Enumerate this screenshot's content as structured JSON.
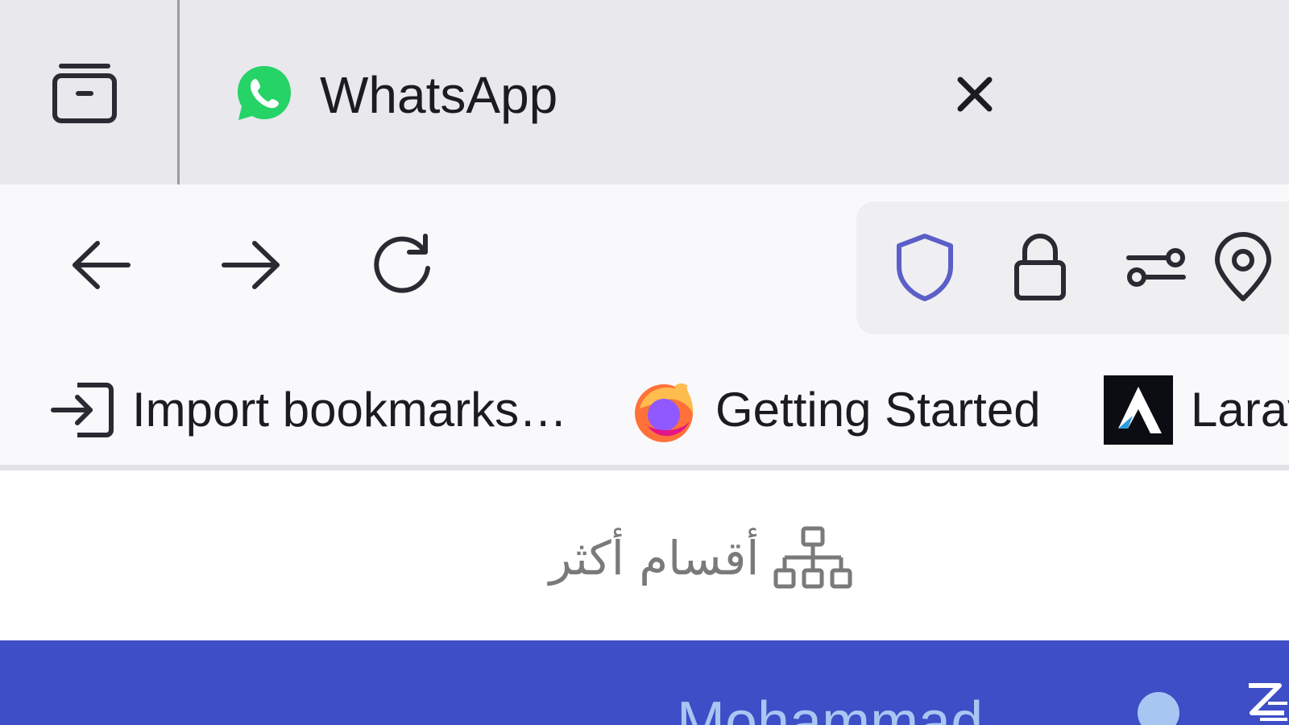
{
  "tabs": [
    {
      "title": "WhatsApp",
      "favicon": "whatsapp-icon",
      "close_icon": "close-icon"
    }
  ],
  "tab_manager_icon": "tab-manager-icon",
  "navigation": {
    "back_icon": "arrow-left-icon",
    "forward_icon": "arrow-right-icon",
    "reload_icon": "reload-icon"
  },
  "urlbar": {
    "icons": [
      "shield-icon",
      "lock-icon",
      "permissions-icon",
      "location-icon"
    ],
    "shield_color": "#5b5fc7"
  },
  "bookmarks": [
    {
      "label": "Import bookmarks…",
      "icon": "import-icon"
    },
    {
      "label": "Getting Started",
      "icon": "firefox-icon"
    },
    {
      "label": "Larav",
      "icon": "laravel-icon"
    }
  ],
  "page": {
    "more_sections_label": "أقسام أكثر",
    "more_sections_icon": "sitemap-icon",
    "user_name": "Mohammad",
    "brand_color": "#3d4ec7"
  }
}
